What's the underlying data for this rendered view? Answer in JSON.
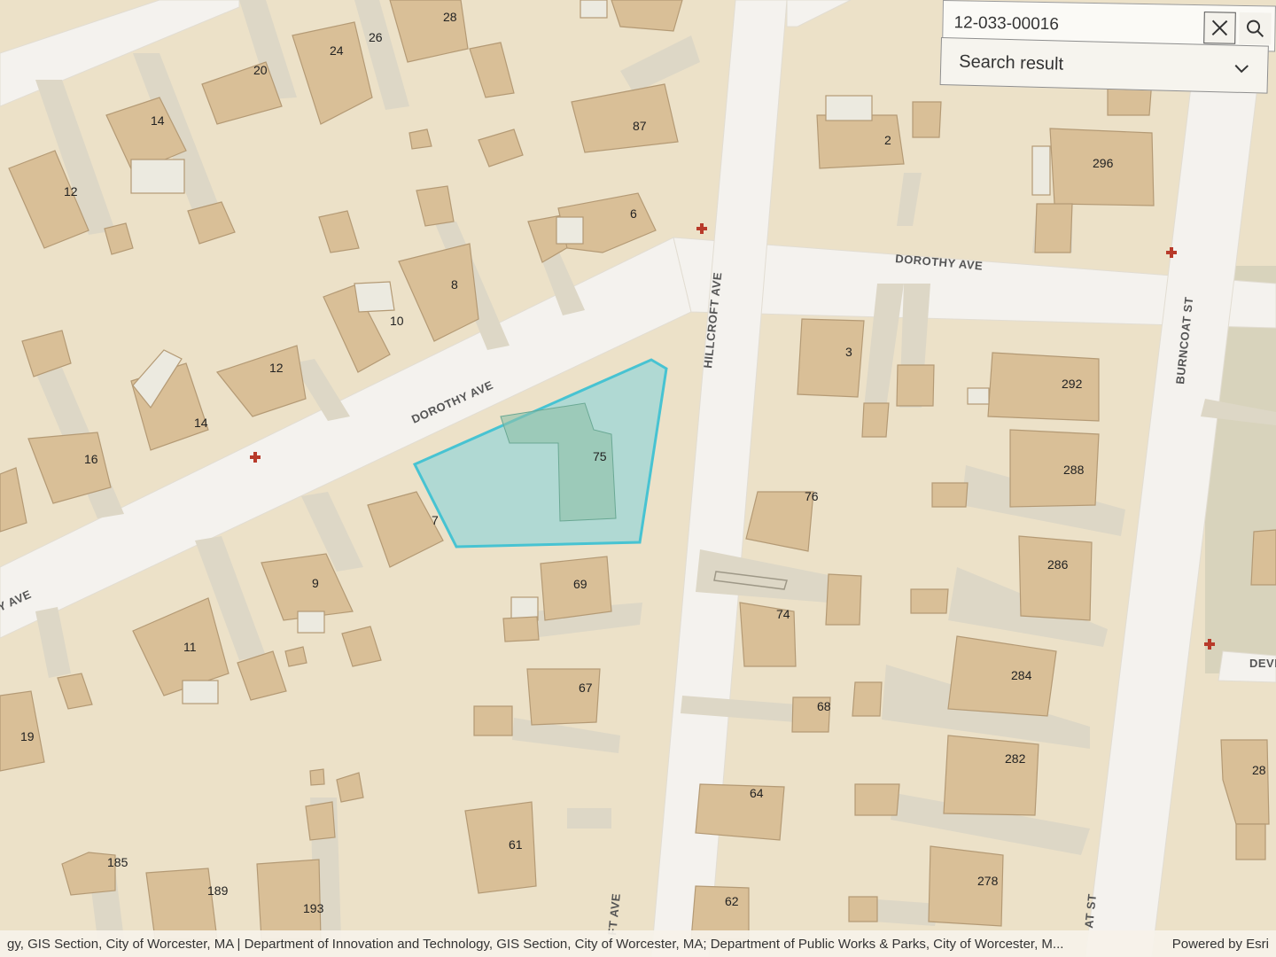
{
  "search": {
    "value": "12-033-00016",
    "clear_icon": "close-icon",
    "search_icon": "search-icon"
  },
  "result": {
    "label": "Search result",
    "expand_icon": "chevron-down-icon"
  },
  "streets": {
    "dorothy_upper": "DOROTHY AVE",
    "dorothy_lower": "DOROTHY AVE",
    "dorothy_left_cut": "Y AVE",
    "hillcroft": "HILLCROFT AVE",
    "hillcroft_bottom_cut": "FT AVE",
    "burncoat": "BURNCOAT ST",
    "burncoat_bottom_cut": "AT ST",
    "deve_cut": "DEVE"
  },
  "parcel": {
    "highlight_color": "#7fd3dc",
    "label": "75",
    "number_7": "7"
  },
  "address_numbers": [
    "28",
    "26",
    "24",
    "20",
    "14",
    "12",
    "87",
    "6",
    "8",
    "10",
    "12",
    "14",
    "16",
    "9",
    "11",
    "19",
    "185",
    "189",
    "193",
    "61",
    "69",
    "67",
    "2",
    "296",
    "3",
    "292",
    "288",
    "286",
    "76",
    "74",
    "68",
    "284",
    "282",
    "64",
    "62",
    "278",
    "28"
  ],
  "hydrant_icon": "hydrant-icon",
  "attribution": {
    "text": "gy, GIS Section, City of Worcester, MA | Department of Innovation and Technology, GIS Section, City of Worcester, MA; Department of Public Works & Parks, City of Worcester, M...",
    "powered_by": "Powered by Esri"
  },
  "colors": {
    "land": "#ece1c8",
    "road": "#f4f2ee",
    "building": "#d9bf97",
    "building_edge": "#b49a75",
    "parcel_highlight": "#7fd3dc"
  }
}
